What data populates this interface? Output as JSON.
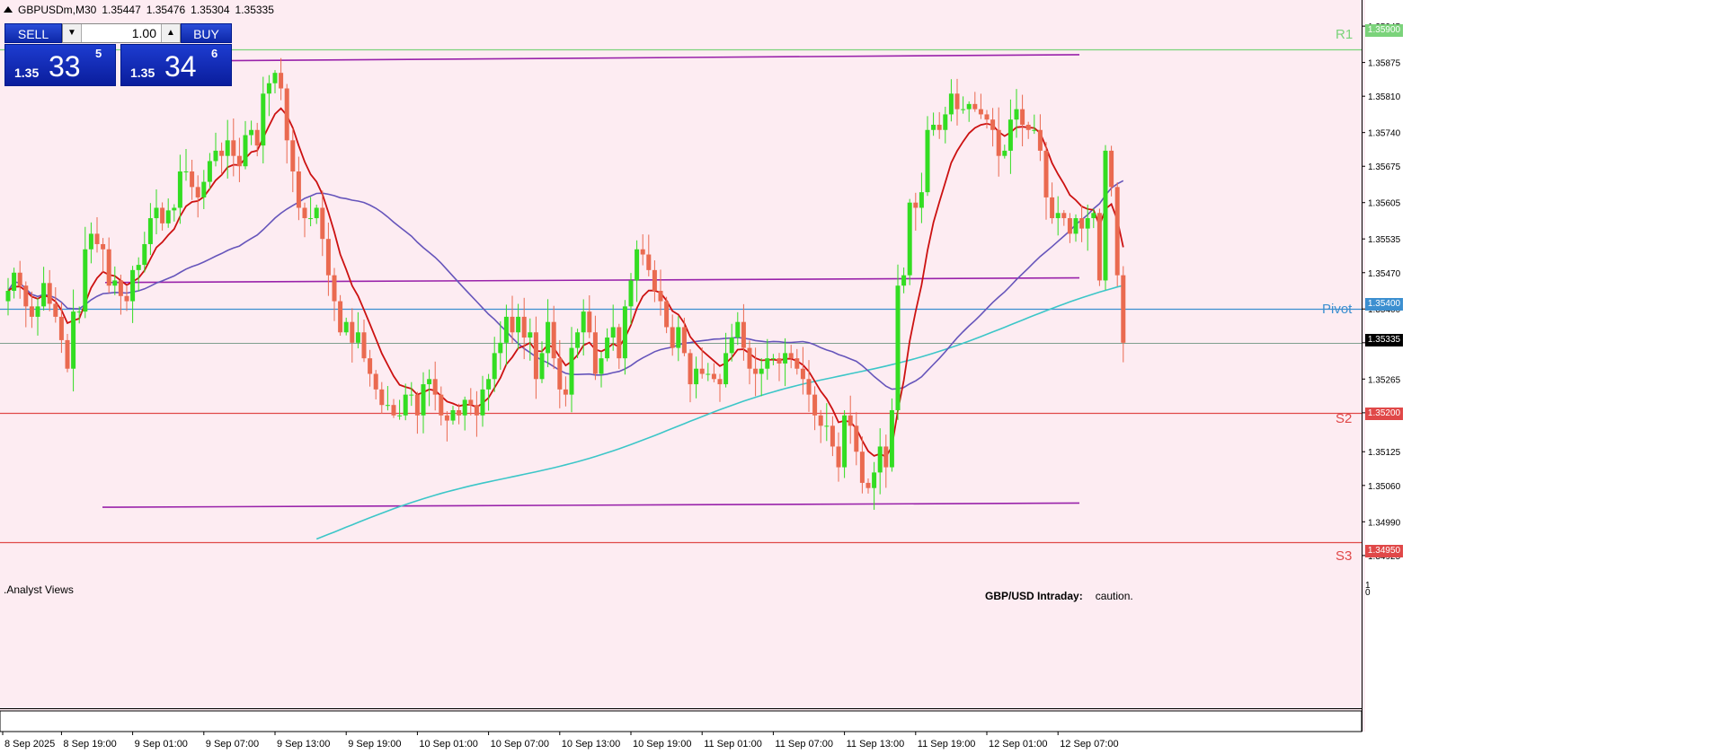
{
  "header": {
    "symbol_timeframe": "GBPUSDm,M30",
    "open": "1.35447",
    "high": "1.35476",
    "low": "1.35304",
    "close": "1.35335"
  },
  "trade_panel": {
    "sell_label": "SELL",
    "buy_label": "BUY",
    "lot_value": "1.00",
    "sell_price": {
      "prefix": "1.35",
      "big": "33",
      "sup": "5"
    },
    "buy_price": {
      "prefix": "1.35",
      "big": "34",
      "sup": "6"
    }
  },
  "levels": [
    {
      "name": "R1",
      "label": "R1",
      "value": "1.35900",
      "color": "#7bd37b"
    },
    {
      "name": "Pivot",
      "label": "Pivot",
      "value": "1.35400",
      "color": "#3c8fd0"
    },
    {
      "name": "S2",
      "label": "S2",
      "value": "1.35200",
      "color": "#e04848"
    },
    {
      "name": "S3",
      "label": "S3",
      "value": "1.34950",
      "color": "#e04848"
    }
  ],
  "current_price": "1.35335",
  "subwindow": {
    "label": ".Analyst Views",
    "scale_top": "1",
    "scale_bottom": "0",
    "ticker_title": "GBP/USD Intraday:",
    "ticker_text": "caution."
  },
  "colors": {
    "background": "#fdecf2",
    "bull": "#33dd22",
    "bear": "#ea6a50",
    "ma_fast": "#cc1111",
    "ma_mid": "#6655bb",
    "ma_slow": "#3cc6c8",
    "channel": "#9922aa"
  },
  "chart_data": {
    "type": "candlestick",
    "symbol": "GBPUSDm",
    "timeframe": "M30",
    "y_ticks": [
      "1.35945",
      "1.35875",
      "1.35810",
      "1.35740",
      "1.35675",
      "1.35605",
      "1.35535",
      "1.35470",
      "1.35400",
      "1.35335",
      "1.35265",
      "1.35200",
      "1.35125",
      "1.35060",
      "1.34990",
      "1.34925"
    ],
    "ylim": [
      1.34885,
      1.35985
    ],
    "x_ticks": [
      {
        "label": "8 Sep 2025",
        "index": -1
      },
      {
        "label": "8 Sep 19:00",
        "index": 9
      },
      {
        "label": "9 Sep 01:00",
        "index": 21
      },
      {
        "label": "9 Sep 07:00",
        "index": 33
      },
      {
        "label": "9 Sep 13:00",
        "index": 45
      },
      {
        "label": "9 Sep 19:00",
        "index": 57
      },
      {
        "label": "10 Sep 01:00",
        "index": 69
      },
      {
        "label": "10 Sep 07:00",
        "index": 81
      },
      {
        "label": "10 Sep 13:00",
        "index": 93
      },
      {
        "label": "10 Sep 19:00",
        "index": 105
      },
      {
        "label": "11 Sep 01:00",
        "index": 117
      },
      {
        "label": "11 Sep 07:00",
        "index": 129
      },
      {
        "label": "11 Sep 13:00",
        "index": 141
      },
      {
        "label": "11 Sep 19:00",
        "index": 153
      },
      {
        "label": "12 Sep 01:00",
        "index": 165
      },
      {
        "label": "12 Sep 07:00",
        "index": 177
      }
    ],
    "close": [
      1.35435,
      1.3547,
      1.35445,
      1.35405,
      1.35385,
      1.35405,
      1.3545,
      1.3541,
      1.35385,
      1.3534,
      1.35285,
      1.35395,
      1.35395,
      1.35515,
      1.35545,
      1.35525,
      1.35515,
      1.35445,
      1.35455,
      1.35425,
      1.35415,
      1.35475,
      1.35485,
      1.35525,
      1.35575,
      1.35595,
      1.35565,
      1.3559,
      1.35595,
      1.35665,
      1.35665,
      1.35635,
      1.35615,
      1.35645,
      1.35685,
      1.35705,
      1.35695,
      1.35725,
      1.35695,
      1.35675,
      1.35735,
      1.35745,
      1.35715,
      1.35815,
      1.35835,
      1.35855,
      1.35825,
      1.35725,
      1.35665,
      1.35595,
      1.35575,
      1.35575,
      1.35595,
      1.35535,
      1.35465,
      1.35415,
      1.35355,
      1.35375,
      1.35335,
      1.35355,
      1.35305,
      1.35275,
      1.35245,
      1.35215,
      1.35215,
      1.35195,
      1.35195,
      1.35235,
      1.35235,
      1.35195,
      1.35255,
      1.35265,
      1.35235,
      1.35195,
      1.35185,
      1.35205,
      1.35195,
      1.35225,
      1.35215,
      1.35195,
      1.35245,
      1.35265,
      1.35315,
      1.35335,
      1.35385,
      1.35355,
      1.35385,
      1.35345,
      1.35355,
      1.35265,
      1.35315,
      1.35375,
      1.35305,
      1.35245,
      1.35235,
      1.35325,
      1.35355,
      1.35395,
      1.35355,
      1.35275,
      1.35305,
      1.35345,
      1.35365,
      1.35305,
      1.35405,
      1.35455,
      1.35515,
      1.35505,
      1.35475,
      1.35435,
      1.35415,
      1.35365,
      1.35325,
      1.35365,
      1.35315,
      1.35255,
      1.35285,
      1.35275,
      1.35275,
      1.35265,
      1.35255,
      1.35315,
      1.35345,
      1.35375,
      1.35325,
      1.35285,
      1.35275,
      1.35285,
      1.35305,
      1.35305,
      1.35295,
      1.35315,
      1.35305,
      1.35285,
      1.35265,
      1.35235,
      1.35195,
      1.35175,
      1.35175,
      1.35135,
      1.35095,
      1.35195,
      1.35175,
      1.35125,
      1.35065,
      1.35055,
      1.35085,
      1.35135,
      1.35095,
      1.35205,
      1.35445,
      1.35465,
      1.35605,
      1.35595,
      1.35625,
      1.35745,
      1.35755,
      1.35745,
      1.35775,
      1.35815,
      1.35785,
      1.35785,
      1.35795,
      1.35785,
      1.35775,
      1.35765,
      1.35745,
      1.35695,
      1.35705,
      1.35765,
      1.35785,
      1.35755,
      1.35745,
      1.35745,
      1.35705,
      1.35615,
      1.35575,
      1.35585,
      1.35575,
      1.35545,
      1.35575,
      1.35555,
      1.35575,
      1.35585,
      1.35455,
      1.35705,
      1.35635,
      1.35465,
      1.35335
    ]
  }
}
